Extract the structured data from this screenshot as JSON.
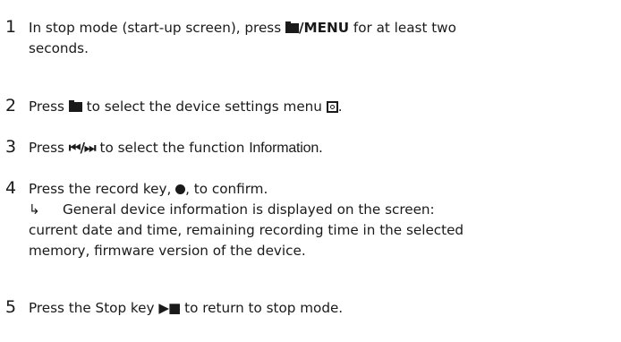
{
  "steps": [
    {
      "number": "1",
      "text_before": "In stop mode (start-up screen), press ",
      "menu_key_label": "/MENU",
      "text_after": " for at least two",
      "line2": "seconds."
    },
    {
      "number": "2",
      "text_before": "Press ",
      "text_middle": " to select the device settings menu ",
      "text_after": ".",
      "folder_icon": "folder-icon",
      "settings_icon": "settings-icon"
    },
    {
      "number": "3",
      "text_before": "Press ",
      "nav_glyph": "⏮/⏭",
      "text_middle": " to select the function ",
      "function_name": "Information",
      "text_after": "."
    },
    {
      "number": "4",
      "line1_before": "Press the record key, ",
      "line1_after": ", to confirm.",
      "result_arrow": "↳",
      "result_line1": "General device information is displayed on the screen:",
      "result_line2": "current date and time, remaining recording time in the selected",
      "result_line3": "memory, firmware version of the device."
    },
    {
      "number": "5",
      "text_before": "Press the Stop key ",
      "stop_glyph": "▶■",
      "text_after": " to return to stop mode."
    }
  ]
}
